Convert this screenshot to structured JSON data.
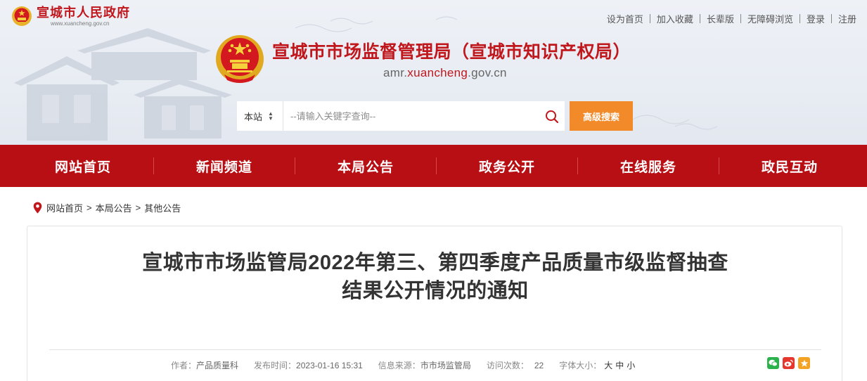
{
  "header": {
    "site_name": "宣城市人民政府",
    "site_url": "www.xuancheng.gov.cn",
    "top_links": [
      "设为首页",
      "加入收藏",
      "长辈版",
      "无障碍浏览",
      "登录",
      "注册"
    ],
    "title": "宣城市市场监督管理局（宣城市知识产权局）",
    "domain_prefix": "amr.",
    "domain_highlight": "xuancheng",
    "domain_suffix": ".gov.cn"
  },
  "search": {
    "scope": "本站",
    "placeholder": "--请输入关键字查询--",
    "advanced_label": "高级搜索"
  },
  "nav": [
    "网站首页",
    "新闻频道",
    "本局公告",
    "政务公开",
    "在线服务",
    "政民互动"
  ],
  "breadcrumb": [
    "网站首页",
    "本局公告",
    "其他公告"
  ],
  "article": {
    "title_line1": "宣城市市场监管局2022年第三、第四季度产品质量市级监督抽查",
    "title_line2": "结果公开情况的通知",
    "author_label": "作者：",
    "author": "产品质量科",
    "date_label": "发布时间：",
    "date": "2023-01-16 15:31",
    "source_label": "信息来源：",
    "source": "市市场监管局",
    "visits_label": "访问次数：",
    "visits": "22",
    "font_label": "字体大小：",
    "font_sizes": [
      "大",
      "中",
      "小"
    ]
  },
  "colors": {
    "brand_red": "#c0171d",
    "nav_red": "#b80f15",
    "search_button": "#f28a2a"
  },
  "icons": {
    "share": [
      "wechat-icon",
      "weibo-icon",
      "favorite-icon"
    ],
    "search": "search-icon",
    "breadcrumb": "location-pin-icon"
  }
}
